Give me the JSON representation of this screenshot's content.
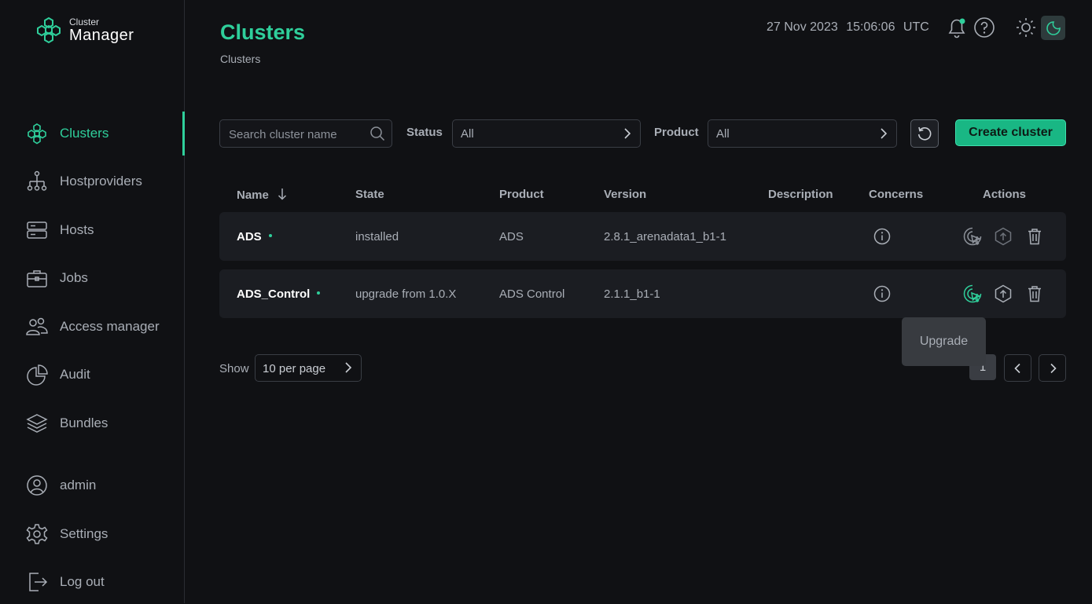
{
  "app": {
    "logo_small": "Cluster",
    "logo_big": "Manager"
  },
  "sidebar": {
    "items": [
      {
        "label": "Clusters",
        "icon": "clusters-icon",
        "active": true
      },
      {
        "label": "Hostproviders",
        "icon": "hostproviders-icon"
      },
      {
        "label": "Hosts",
        "icon": "hosts-icon"
      },
      {
        "label": "Jobs",
        "icon": "jobs-icon"
      },
      {
        "label": "Access manager",
        "icon": "users-icon"
      },
      {
        "label": "Audit",
        "icon": "pie-chart-icon"
      },
      {
        "label": "Bundles",
        "icon": "layers-icon"
      }
    ],
    "bottom": [
      {
        "label": "admin",
        "icon": "user-icon"
      },
      {
        "label": "Settings",
        "icon": "gear-icon"
      },
      {
        "label": "Log out",
        "icon": "logout-icon"
      }
    ]
  },
  "header": {
    "title": "Clusters",
    "breadcrumb": "Clusters",
    "date": "27 Nov 2023",
    "time": "15:06:06",
    "timezone": "UTC",
    "icons": [
      "bell-icon",
      "help-icon",
      "sun-icon",
      "moon-icon"
    ]
  },
  "toolbar": {
    "search_placeholder": "Search cluster name",
    "status_label": "Status",
    "status_value": "All",
    "product_label": "Product",
    "product_value": "All",
    "create_label": "Create cluster"
  },
  "table": {
    "columns": [
      "Name",
      "State",
      "Product",
      "Version",
      "Description",
      "Concerns",
      "Actions"
    ],
    "rows": [
      {
        "name": "ADS",
        "state": "installed",
        "product": "ADS",
        "version": "2.8.1_arenadata1_b1-1",
        "description": ""
      },
      {
        "name": "ADS_Control",
        "state": "upgrade from 1.0.X",
        "product": "ADS Control",
        "version": "2.1.1_b1-1",
        "description": ""
      }
    ]
  },
  "tooltip": {
    "text": "Upgrade"
  },
  "pagination": {
    "show_label": "Show",
    "per_page": "10 per page",
    "current_page": "1"
  },
  "colors": {
    "accent": "#2fcf9b",
    "background": "#101114",
    "row": "#1b1d22"
  }
}
